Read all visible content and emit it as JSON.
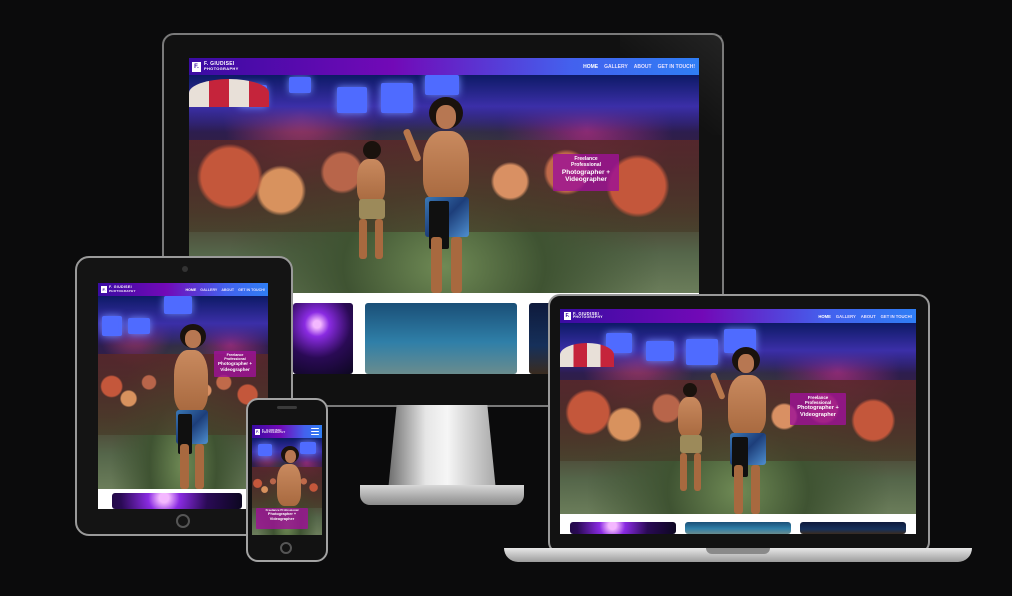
{
  "site": {
    "logo_mark": "F.",
    "logo_line1": "F. GIUDISEI",
    "logo_line2": "PHOTOGRAPHY",
    "nav": [
      "HOME",
      "GALLERY",
      "ABOUT",
      "GET IN TOUCH!"
    ],
    "tagline_small_1": "Freelance",
    "tagline_small_2": "Professional",
    "tagline_big_1": "Photographer +",
    "tagline_big_2": "Videographer",
    "tagline_phone_small": "Freelance Professional"
  },
  "devices": [
    "desktop-monitor",
    "tablet",
    "phone",
    "laptop"
  ],
  "icons": {
    "menu": "hamburger-icon"
  },
  "colors": {
    "nav_start": "#3a0ca3",
    "nav_mid": "#7209b7",
    "nav_end": "#2f7ef5",
    "tagline_bg": "#9e1296",
    "background": "#0b0b0c"
  }
}
